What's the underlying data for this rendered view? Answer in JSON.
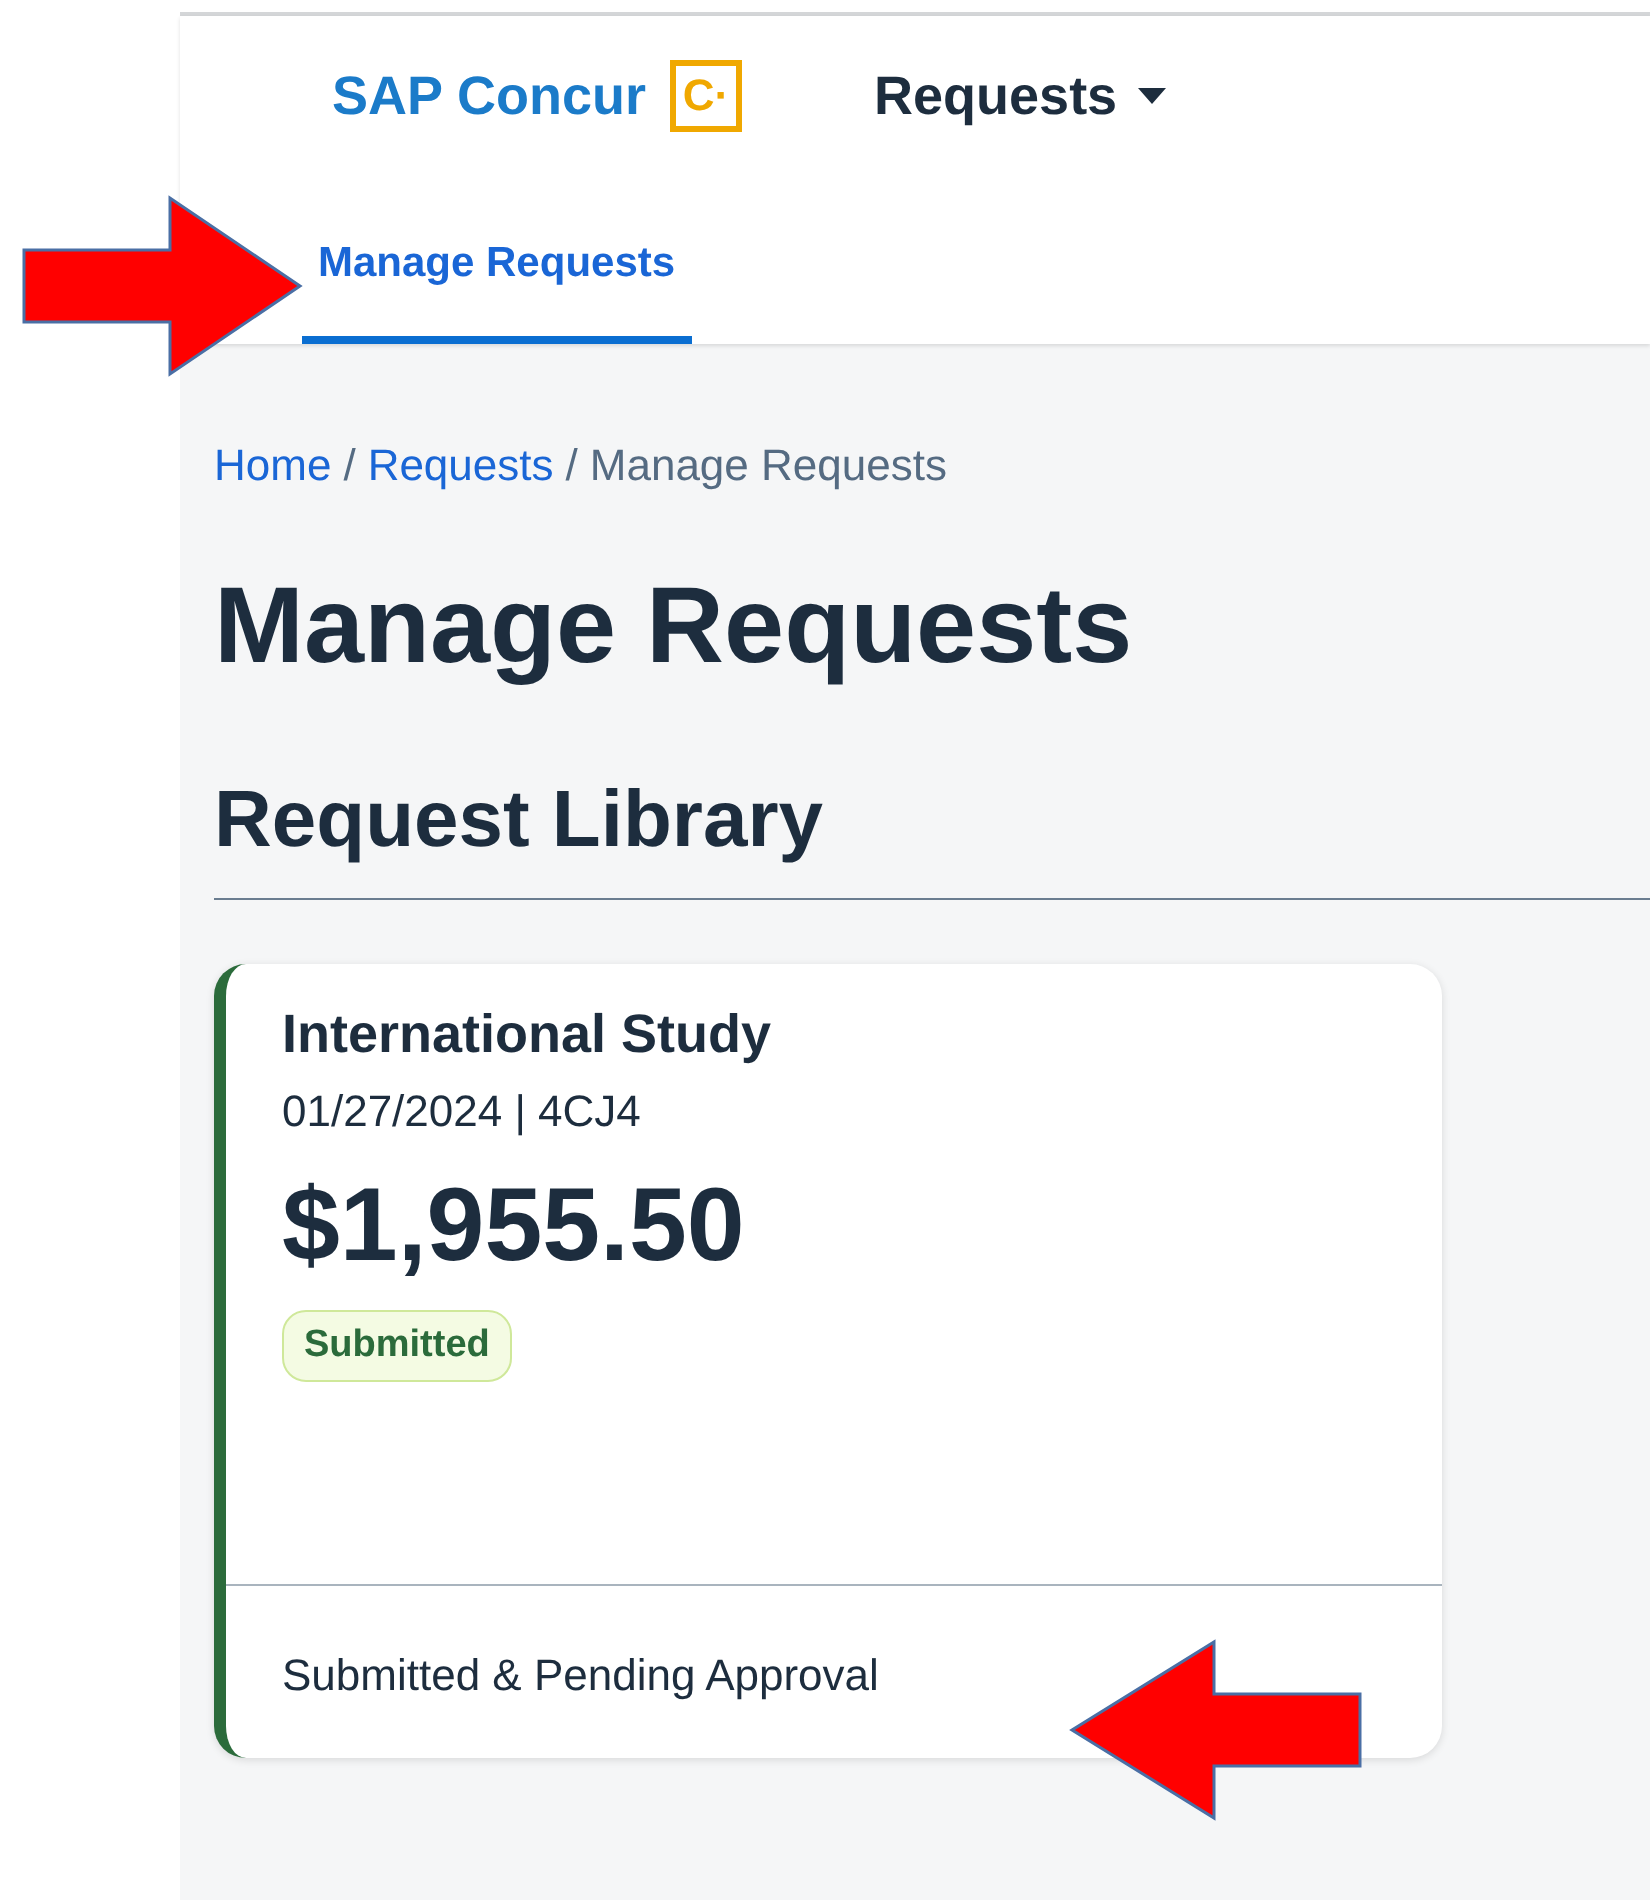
{
  "header": {
    "logo": {
      "text": "SAP Concur",
      "mark": "C·"
    },
    "nav": [
      {
        "label": "Requests",
        "has_menu": true
      }
    ]
  },
  "tabs": [
    {
      "label": "Manage Requests",
      "selected": true
    }
  ],
  "breadcrumb": {
    "separator": "/",
    "items": [
      {
        "label": "Home",
        "kind": "link"
      },
      {
        "label": "Requests",
        "kind": "link"
      },
      {
        "label": "Manage Requests",
        "kind": "current"
      }
    ]
  },
  "page_title": "Manage Requests",
  "section_title": "Request Library",
  "requests": [
    {
      "title": "International Study",
      "meta": "01/27/2024 | 4CJ4",
      "amount": "$1,955.50",
      "status": "Submitted",
      "color": "#2b6b3b",
      "footer": "Submitted & Pending Approval"
    }
  ],
  "annotations": [
    {
      "kind": "arrow-right"
    },
    {
      "kind": "arrow-left"
    }
  ]
}
